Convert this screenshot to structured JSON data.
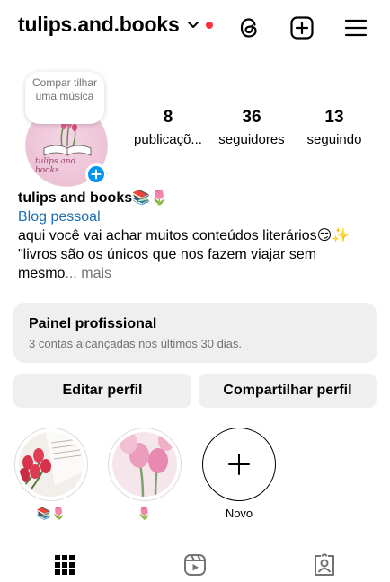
{
  "header": {
    "username": "tulips.and.books",
    "icons": [
      "chevron-down-icon",
      "threads-icon",
      "create-icon",
      "menu-icon"
    ]
  },
  "profile": {
    "note": "Compar tilhar uma música",
    "avatar_text": "tulips and books",
    "stats": [
      {
        "value": "8",
        "label": "publicaçõ..."
      },
      {
        "value": "36",
        "label": "seguidores"
      },
      {
        "value": "13",
        "label": "seguindo"
      }
    ]
  },
  "bio": {
    "name": "tulips and books📚🌷",
    "category": "Blog pessoal",
    "line1": "aqui você vai achar muitos conteúdos literários😏✨",
    "line2": "\"livros são os únicos que nos fazem viajar sem",
    "line3": "mesmo",
    "more": "... mais"
  },
  "panel": {
    "title": "Painel profissional",
    "subtitle": "3 contas alcançadas nos últimos 30 dias."
  },
  "buttons": {
    "edit": "Editar perfil",
    "share": "Compartilhar perfil"
  },
  "highlights": [
    {
      "label": "📚🌷"
    },
    {
      "label": "🌷"
    },
    {
      "label": "Novo"
    }
  ],
  "colors": {
    "accent": "#0095f6",
    "notification": "#ff3040",
    "link": "#1b6fb5",
    "panel_bg": "#efefef"
  }
}
